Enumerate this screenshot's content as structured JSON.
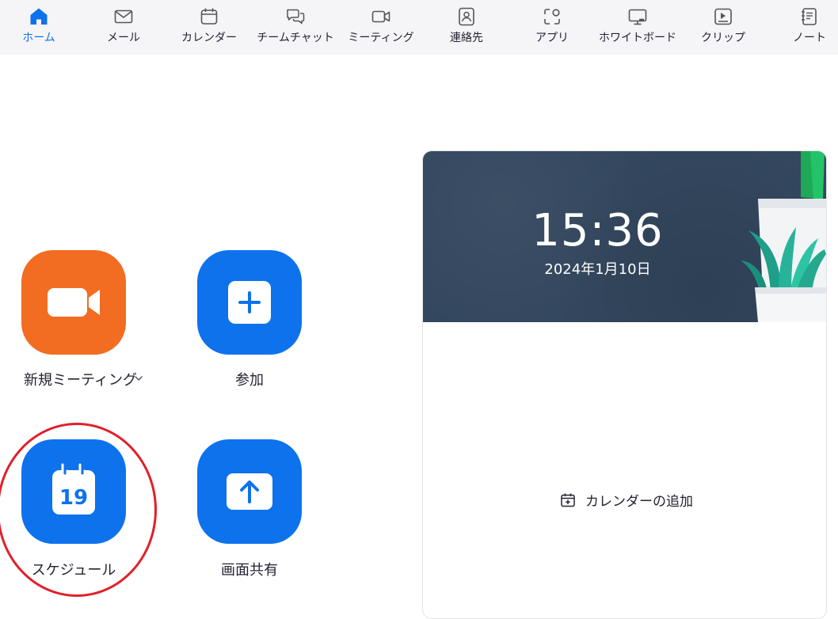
{
  "nav": {
    "items": [
      {
        "label": "ホーム",
        "icon": "home-icon",
        "active": true
      },
      {
        "label": "メール",
        "icon": "mail-icon"
      },
      {
        "label": "カレンダー",
        "icon": "calendar-icon"
      },
      {
        "label": "チームチャット",
        "icon": "chat-icon"
      },
      {
        "label": "ミーティング",
        "icon": "video-icon"
      },
      {
        "label": "連絡先",
        "icon": "contacts-icon"
      },
      {
        "label": "アプリ",
        "icon": "apps-icon"
      },
      {
        "label": "ホワイトボード",
        "icon": "whiteboard-icon"
      },
      {
        "label": "クリップ",
        "icon": "clips-icon"
      },
      {
        "label": "ノート",
        "icon": "notes-icon"
      }
    ],
    "active_color": "#0e72ed"
  },
  "actions": {
    "new_meeting": {
      "label": "新規ミーティング",
      "icon": "video-camera-icon",
      "color": "#f26d21"
    },
    "join": {
      "label": "参加",
      "icon": "plus-icon",
      "color": "#0e72ed"
    },
    "schedule": {
      "label": "スケジュール",
      "icon": "calendar-icon",
      "calendar_day": "19",
      "color": "#0e72ed",
      "highlighted": true
    },
    "share_screen": {
      "label": "画面共有",
      "icon": "upload-arrow-icon",
      "color": "#0e72ed"
    }
  },
  "calendar_card": {
    "time": "15:36",
    "date": "2024年1月10日",
    "add_calendar_label": "カレンダーの追加"
  },
  "colors": {
    "highlight": "#e0202b",
    "card_header": "#33475e"
  }
}
